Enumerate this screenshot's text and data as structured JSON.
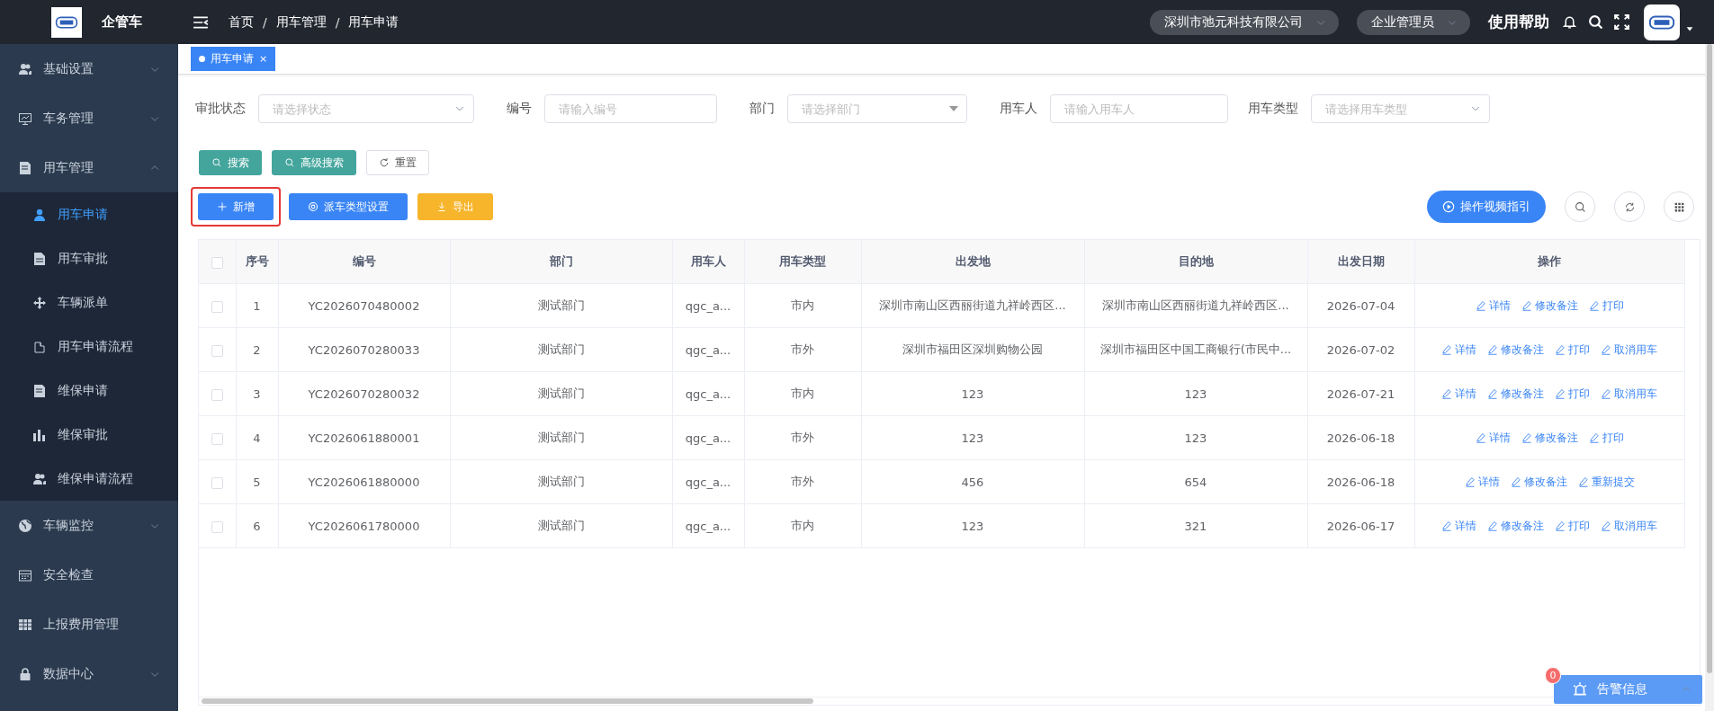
{
  "header": {
    "app_name": "企管车",
    "breadcrumb": [
      {
        "kind": "link",
        "text": "首页"
      },
      {
        "kind": "separator",
        "text": "/"
      },
      {
        "kind": "link",
        "text": "用车管理"
      },
      {
        "kind": "separator",
        "text": "/"
      },
      {
        "kind": "link",
        "text": "用车申请"
      }
    ],
    "company": "深圳市弛元科技有限公司",
    "role": "企业管理员",
    "help": "使用帮助"
  },
  "sidebar": {
    "items": [
      {
        "label": "基础设置",
        "kind": "group",
        "expanded": false
      },
      {
        "label": "车务管理",
        "kind": "group",
        "expanded": false
      },
      {
        "label": "用车管理",
        "kind": "group",
        "expanded": true,
        "children": [
          {
            "label": "用车申请",
            "selected": true
          },
          {
            "label": "用车审批",
            "selected": false
          },
          {
            "label": "车辆派单",
            "selected": false
          },
          {
            "label": "用车申请流程",
            "selected": false
          },
          {
            "label": "维保申请",
            "selected": false
          },
          {
            "label": "维保审批",
            "selected": false
          },
          {
            "label": "维保申请流程",
            "selected": false
          }
        ]
      },
      {
        "label": "车辆监控",
        "kind": "group",
        "expanded": false
      },
      {
        "label": "安全检查",
        "kind": "link"
      },
      {
        "label": "上报费用管理",
        "kind": "link"
      },
      {
        "label": "数据中心",
        "kind": "group",
        "expanded": false
      }
    ]
  },
  "tabs": [
    {
      "label": "用车申请",
      "selected": true,
      "close": "×"
    }
  ],
  "filters": [
    {
      "label": "审批状态",
      "placeholder": "请选择状态",
      "kind": "select"
    },
    {
      "label": "编号",
      "placeholder": "请输入编号",
      "kind": "input"
    },
    {
      "label": "部门",
      "placeholder": "请选择部门",
      "kind": "tree"
    },
    {
      "label": "用车人",
      "placeholder": "请输入用车人",
      "kind": "input"
    },
    {
      "label": "用车类型",
      "placeholder": "请选择用车类型",
      "kind": "select"
    }
  ],
  "search_buttons": [
    {
      "label": "搜索",
      "kind": "search"
    },
    {
      "label": "高级搜索",
      "kind": "search"
    },
    {
      "label": "重置",
      "kind": "reset"
    }
  ],
  "toolbar": [
    {
      "label": "新增",
      "kind": "add",
      "highlighted": true
    },
    {
      "label": "派车类型设置",
      "kind": "settings",
      "highlighted": false
    },
    {
      "label": "导出",
      "kind": "export",
      "highlighted": false
    }
  ],
  "guide_button": "操作视频指引",
  "table": {
    "all_checked": false,
    "columns": [
      "序号",
      "编号",
      "部门",
      "用车人",
      "用车类型",
      "出发地",
      "目的地",
      "出发日期",
      "操作"
    ],
    "rows": [
      {
        "checked": false,
        "cells": [
          "1",
          "YC2026070480002",
          "测试部门",
          "qgc_a...",
          "市内",
          "深圳市南山区西丽街道九祥岭西区...",
          "深圳市南山区西丽街道九祥岭西区...",
          "2026-07-04"
        ],
        "actions": [
          "详情",
          "修改备注",
          "打印"
        ]
      },
      {
        "checked": false,
        "cells": [
          "2",
          "YC2026070280033",
          "测试部门",
          "qgc_a...",
          "市外",
          "深圳市福田区深圳购物公园",
          "深圳市福田区中国工商银行(市民中...",
          "2026-07-02"
        ],
        "actions": [
          "详情",
          "修改备注",
          "打印",
          "取消用车"
        ]
      },
      {
        "checked": false,
        "cells": [
          "3",
          "YC2026070280032",
          "测试部门",
          "qgc_a...",
          "市内",
          "123",
          "123",
          "2026-07-21"
        ],
        "actions": [
          "详情",
          "修改备注",
          "打印",
          "取消用车"
        ]
      },
      {
        "checked": false,
        "cells": [
          "4",
          "YC2026061880001",
          "测试部门",
          "qgc_a...",
          "市外",
          "123",
          "123",
          "2026-06-18"
        ],
        "actions": [
          "详情",
          "修改备注",
          "打印"
        ]
      },
      {
        "checked": false,
        "cells": [
          "5",
          "YC2026061880000",
          "测试部门",
          "qgc_a...",
          "市外",
          "456",
          "654",
          "2026-06-18"
        ],
        "actions": [
          "详情",
          "修改备注",
          "重新提交"
        ]
      },
      {
        "checked": false,
        "cells": [
          "6",
          "YC2026061780000",
          "测试部门",
          "qgc_a...",
          "市内",
          "123",
          "321",
          "2026-06-17"
        ],
        "actions": [
          "详情",
          "修改备注",
          "打印",
          "取消用车"
        ]
      }
    ]
  },
  "alarm": {
    "count": "0",
    "label": "告警信息"
  }
}
